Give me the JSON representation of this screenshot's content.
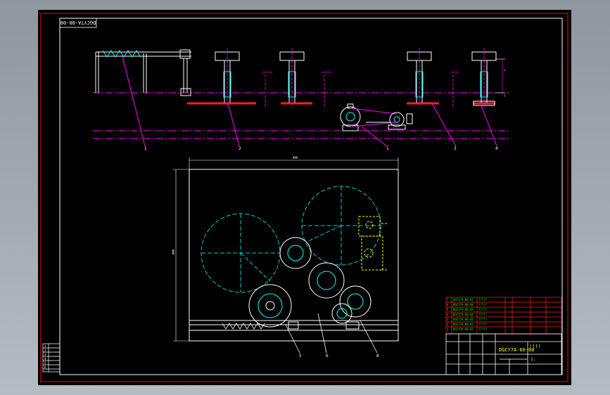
{
  "drawing_number_stamp": "DGCY7A-00-00",
  "top_view": {
    "item_balloons": [
      "1",
      "2",
      "1",
      "3",
      "4"
    ],
    "dimension_labels": [
      "?",
      "?",
      "?"
    ],
    "small_annotations": [
      "xxxxxx",
      "xxxxxx",
      "xxxxx"
    ]
  },
  "bottom_view": {
    "overall_width_dim": "###",
    "overall_height_dim": "###",
    "item_balloons": [
      "5",
      "6",
      "8"
    ]
  },
  "title_block": {
    "drawing_number": "DGCY7A-00-00",
    "marks": "!!!!",
    "scale": "1:",
    "parts_rows": [
      {
        "no": "7",
        "code": "DGCY7A-00-07",
        "name": "?????"
      },
      {
        "no": "6",
        "code": "DGCY7A-00-06",
        "name": "?????"
      },
      {
        "no": "5",
        "code": "DGCY7A-00-05",
        "name": "?????"
      },
      {
        "no": "4",
        "code": "DGCY7A-00-04",
        "name": "?????"
      },
      {
        "no": "3",
        "code": "DGCY7A-00-03",
        "name": "?????"
      },
      {
        "no": "2",
        "code": "DGCY7A-00-02",
        "name": "?????"
      },
      {
        "no": "1",
        "code": "DGCY7A-00-01",
        "name": "?????"
      }
    ]
  },
  "revision_table": [
    "1",
    "2",
    "3",
    "4",
    "5",
    "6"
  ],
  "colors": {
    "frame": "#ff0000",
    "white": "#ffffff",
    "cyan": "#00ffff",
    "magenta": "#ff00ff",
    "yellow": "#ffff00",
    "green": "#00ff00",
    "red": "#ff2020"
  }
}
